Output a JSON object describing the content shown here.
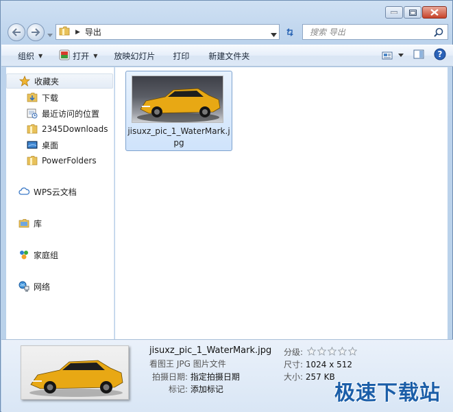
{
  "address": {
    "crumb": "导出"
  },
  "search": {
    "placeholder": "搜索 导出"
  },
  "toolbar": {
    "organize": "组织",
    "open": "打开",
    "slideshow": "放映幻灯片",
    "print": "打印",
    "new_folder": "新建文件夹"
  },
  "sidebar": {
    "favorites": "收藏夹",
    "items": [
      {
        "label": "下载"
      },
      {
        "label": "最近访问的位置"
      },
      {
        "label": "2345Downloads"
      },
      {
        "label": "桌面"
      },
      {
        "label": "PowerFolders"
      }
    ],
    "wps": "WPS云文档",
    "libraries": "库",
    "homegroup": "家庭组",
    "network": "网络"
  },
  "file": {
    "name": "jisuxz_pic_1_WaterMark.jpg"
  },
  "details": {
    "name": "jisuxz_pic_1_WaterMark.jpg",
    "type": "看图王 JPG 图片文件",
    "date_label": "拍摄日期:",
    "date_value": "指定拍摄日期",
    "tags_label": "标记:",
    "tags_value": "添加标记",
    "rating_label": "分级:",
    "rating_value": 0,
    "dims_label": "尺寸:",
    "dims_value": "1024 x 512",
    "size_label": "大小:",
    "size_value": "257 KB"
  },
  "watermark": "极速下载站",
  "colors": {
    "accent": "#1b5ea8",
    "selection": "#cfe3fb",
    "car": "#e8a814"
  }
}
